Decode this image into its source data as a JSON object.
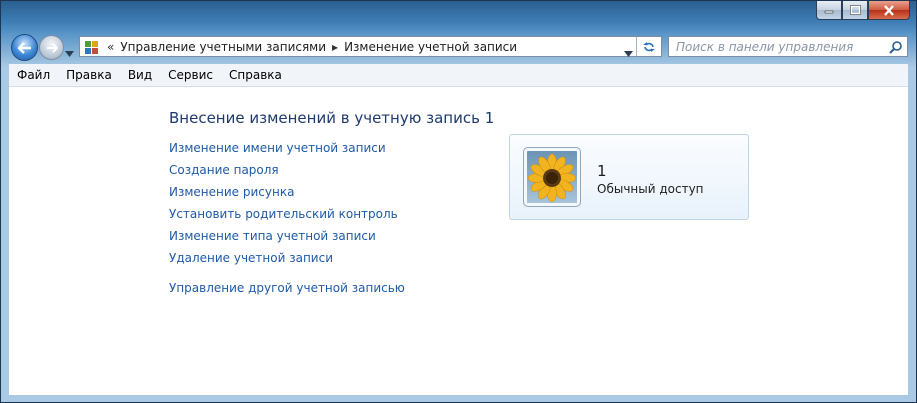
{
  "window": {
    "caption_buttons": [
      "minimize",
      "maximize",
      "close"
    ]
  },
  "navigation": {
    "address": {
      "overflow": "«",
      "crumbs": [
        "Управление учетными записями",
        "Изменение учетной записи"
      ]
    },
    "search": {
      "placeholder": "Поиск в панели управления"
    }
  },
  "menu": {
    "items": [
      "Файл",
      "Правка",
      "Вид",
      "Сервис",
      "Справка"
    ]
  },
  "main": {
    "title": "Внесение изменений в учетную запись 1",
    "links": [
      "Изменение имени учетной записи",
      "Создание пароля",
      "Изменение рисунка",
      "Установить родительский контроль",
      "Изменение типа учетной записи",
      "Удаление учетной записи"
    ],
    "other_link": "Управление другой учетной записью"
  },
  "account": {
    "name": "1",
    "type": "Обычный доступ",
    "picture": "sunflower-picture"
  },
  "colors": {
    "link": "#1f5aa6",
    "title": "#1e3a6c",
    "frame": "#a9c9e4"
  }
}
